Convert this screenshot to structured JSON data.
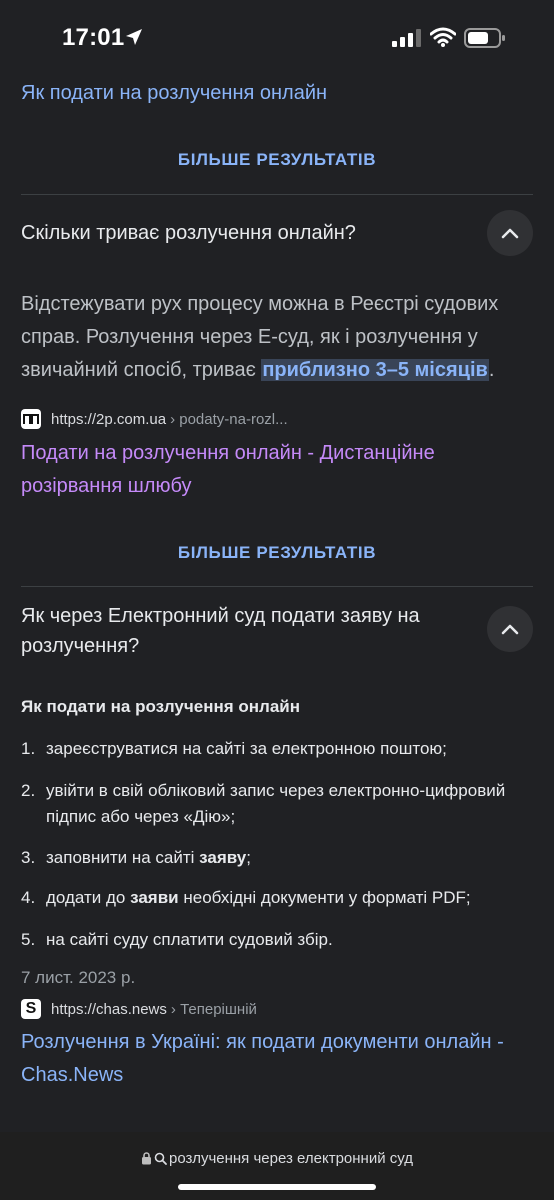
{
  "status_bar": {
    "time": "17:01",
    "icons": [
      "location-arrow-icon",
      "cellular-signal-icon",
      "wifi-icon",
      "battery-icon"
    ]
  },
  "top_link": "Як подати на розлучення онлайн",
  "more_results_label": "БІЛЬШЕ РЕЗУЛЬТАТІВ",
  "faq1": {
    "question": "Скільки триває розлучення онлайн?",
    "answer_before": "Відстежувати рух процесу можна в Реєстрі судових справ. Розлучення через Е-суд, як і розлучення у звичайний спосіб, триває ",
    "answer_highlight": "приблизно 3–5 місяців",
    "answer_after": ".",
    "source_url": "https://2p.com.ua",
    "source_path": "› podaty-na-rozl...",
    "result_title": "Подати на розлучення онлайн - Дистанційне розірвання шлюбу"
  },
  "faq2": {
    "question": "Як через Електронний суд подати заяву на розлучення?",
    "list_heading": "Як подати на розлучення онлайн",
    "steps": [
      {
        "num": "1.",
        "pre": "зареєструватися на сайті за електронною поштою;",
        "bold": "",
        "post": ""
      },
      {
        "num": "2.",
        "pre": "увійти в свій обліковий запис через електронно-цифровий підпис або через «Дію»;",
        "bold": "",
        "post": ""
      },
      {
        "num": "3.",
        "pre": "заповнити на сайті ",
        "bold": "заяву",
        "post": ";"
      },
      {
        "num": "4.",
        "pre": "додати до ",
        "bold": "заяви",
        "post": " необхідні документи у форматі PDF;"
      },
      {
        "num": "5.",
        "pre": "на сайті суду сплатити судовий збір.",
        "bold": "",
        "post": ""
      }
    ],
    "date": "7 лист. 2023 р.",
    "source_url": "https://chas.news",
    "source_path": "› Теперішній",
    "result_title": "Розлучення в Україні: як подати документи онлайн - Chas.News"
  },
  "address_bar": {
    "query": "розлучення через електронний суд"
  },
  "colors": {
    "background": "#202124",
    "link": "#8ab4f8",
    "visited_link": "#c58af9",
    "text": "#e8eaed"
  }
}
